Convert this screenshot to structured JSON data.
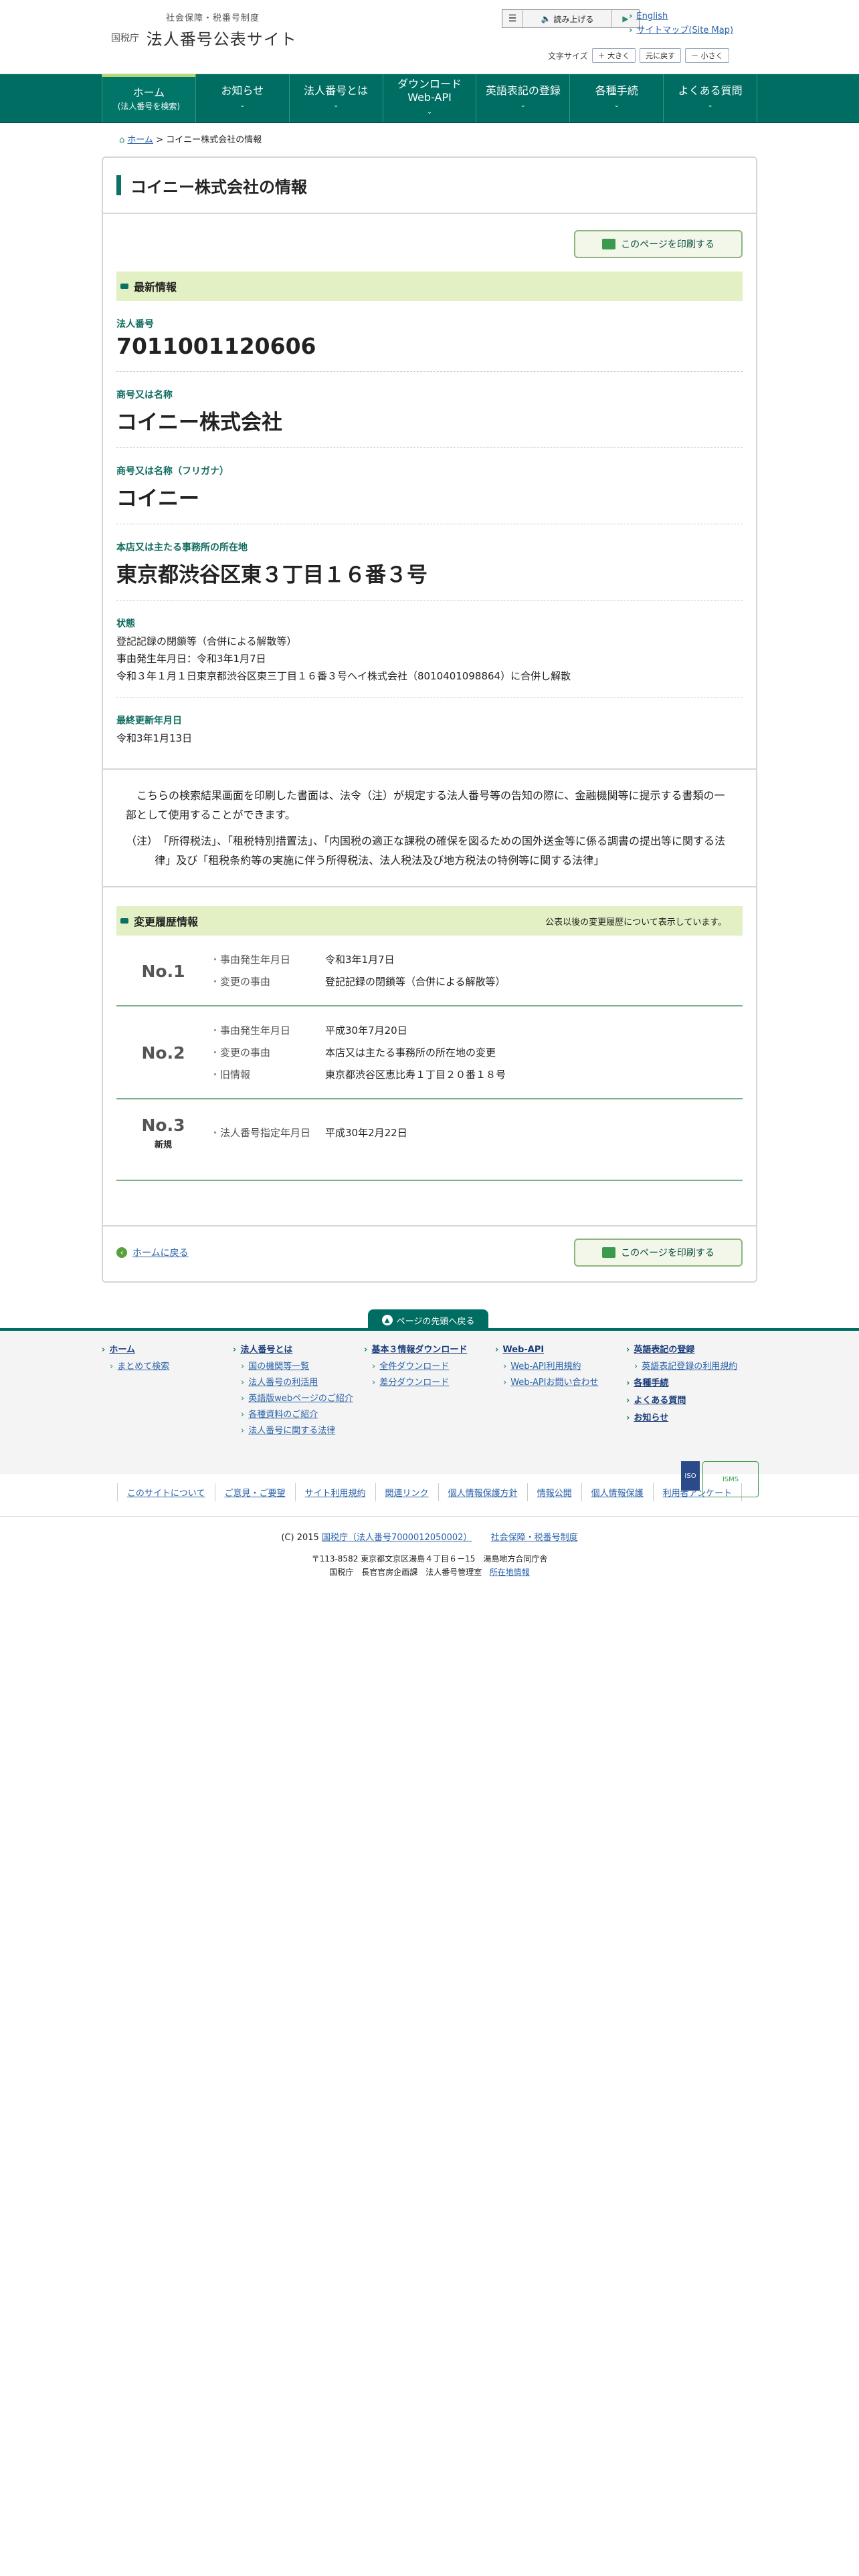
{
  "header": {
    "sub": "社会保障・税番号制度",
    "agency": "国税庁",
    "title": "法人番号公表サイト",
    "read_label": "読み上げる",
    "links": [
      "English",
      "サイトマップ(Site Map)"
    ],
    "fontsize_label": "文字サイズ",
    "font_buttons": [
      "＋ 大きく",
      "元に戻す",
      "－ 小さく"
    ]
  },
  "nav": [
    {
      "label": "ホーム",
      "sub": "(法人番号を検索)"
    },
    {
      "label": "お知らせ",
      "sub": ""
    },
    {
      "label": "法人番号とは",
      "sub": ""
    },
    {
      "label": "ダウンロード",
      "sub": "Web-API"
    },
    {
      "label": "英語表記の登録",
      "sub": ""
    },
    {
      "label": "各種手続",
      "sub": ""
    },
    {
      "label": "よくある質問",
      "sub": ""
    }
  ],
  "breadcrumb": {
    "home": "ホーム",
    "sep": ">",
    "current": "コイニー株式会社の情報"
  },
  "page": {
    "title": "コイニー株式会社の情報",
    "print_label": "このページを印刷する",
    "latest_heading": "最新情報",
    "fields": {
      "number_label": "法人番号",
      "number": "7011001120606",
      "name_label": "商号又は名称",
      "name": "コイニー株式会社",
      "furigana_label": "商号又は名称（フリガナ）",
      "furigana": "コイニー",
      "address_label": "本店又は主たる事務所の所在地",
      "address": "東京都渋谷区東３丁目１６番３号",
      "status_label": "状態",
      "status_lines": [
        "登記記録の閉鎖等（合併による解散等）",
        "事由発生年月日：令和3年1月7日",
        "令和３年１月１日東京都渋谷区東三丁目１６番３号ヘイ株式会社（8010401098864）に合併し解散"
      ],
      "updated_label": "最終更新年月日",
      "updated": "令和3年1月13日"
    },
    "note1": "こちらの検索結果画面を印刷した書面は、法令（注）が規定する法人番号等の告知の際に、金融機関等に提示する書類の一部として使用することができます。",
    "note2": "（注）　「所得税法」、「租税特別措置法」、「内国税の適正な課税の確保を図るための国外送金等に係る調書の提出等に関する法律」及び「租税条約等の実施に伴う所得税法、法人税法及び地方税法の特例等に関する法律」",
    "history_heading": "変更履歴情報",
    "history_note": "公表以後の変更履歴について表示しています。",
    "history": [
      {
        "no": "No.1",
        "new": "",
        "lines": [
          [
            "事由発生年月日",
            "令和3年1月7日"
          ],
          [
            "変更の事由",
            "登記記録の閉鎖等（合併による解散等）"
          ]
        ]
      },
      {
        "no": "No.2",
        "new": "",
        "lines": [
          [
            "事由発生年月日",
            "平成30年7月20日"
          ],
          [
            "変更の事由",
            "本店又は主たる事務所の所在地の変更"
          ],
          [
            "旧情報",
            "東京都渋谷区恵比寿１丁目２０番１８号"
          ]
        ]
      },
      {
        "no": "No.3",
        "new": "新規",
        "lines": [
          [
            "法人番号指定年月日",
            "平成30年2月22日"
          ]
        ]
      }
    ],
    "back_label": "ホームに戻る"
  },
  "pagetop_label": "ページの先頭へ戻る",
  "footer": {
    "cols": [
      {
        "head": "ホーム",
        "items": [
          "まとめて検索"
        ]
      },
      {
        "head": "法人番号とは",
        "items": [
          "国の機関等一覧",
          "法人番号の利活用",
          "英語版webページのご紹介",
          "各種資料のご紹介",
          "法人番号に関する法律"
        ]
      },
      {
        "head": "基本３情報ダウンロード",
        "items": [
          "全件ダウンロード",
          "差分ダウンロード"
        ]
      },
      {
        "head": "Web-API",
        "items": [
          "Web-API利用規約",
          "Web-APIお問い合わせ"
        ]
      },
      {
        "head": "英語表記の登録",
        "items": [
          "英語表記登録の利用規約"
        ],
        "extra_heads": [
          "各種手続",
          "よくある質問",
          "お知らせ"
        ]
      }
    ],
    "links": [
      "このサイトについて",
      "ご意見・ご要望",
      "サイト利用規約",
      "関連リンク",
      "個人情報保護方針",
      "情報公開",
      "個人情報保護",
      "利用者アンケート"
    ],
    "copyright": "(C) 2015",
    "copyright_link": "国税庁（法人番号7000012050002）",
    "org_link": "社会保障・税番号制度",
    "address1": "〒113-8582 東京都文京区湯島４丁目６－15　湯島地方合同庁舎",
    "address2": "国税庁　長官官房企画課　法人番号管理室",
    "map_link": "所在地情報",
    "badge1": "ISO",
    "badge2": "ISMS"
  }
}
